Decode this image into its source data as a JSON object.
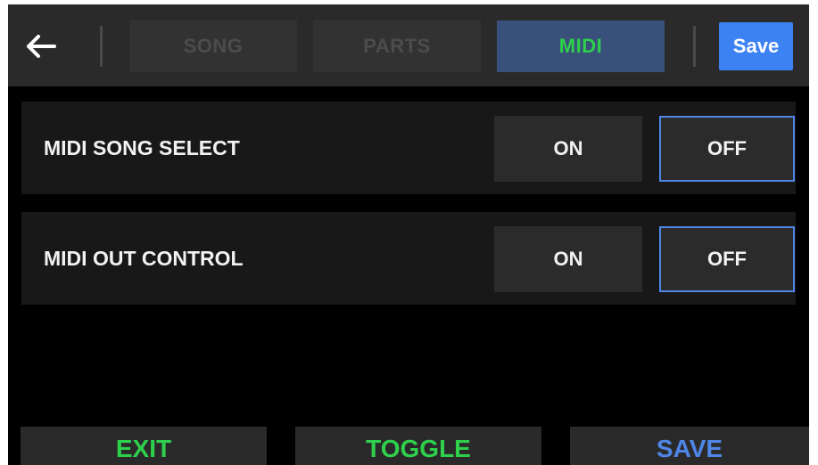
{
  "header": {
    "back_icon": "arrow-left-icon",
    "tabs": [
      {
        "label": "SONG",
        "active": false
      },
      {
        "label": "PARTS",
        "active": false
      },
      {
        "label": "MIDI",
        "active": true
      }
    ],
    "save_label": "Save"
  },
  "settings": [
    {
      "label": "MIDI SONG SELECT",
      "on_label": "ON",
      "off_label": "OFF",
      "selected": "OFF"
    },
    {
      "label": "MIDI OUT CONTROL",
      "on_label": "ON",
      "off_label": "OFF",
      "selected": "OFF"
    }
  ],
  "footer": {
    "exit_label": "EXIT",
    "toggle_label": "TOGGLE",
    "save_label": "SAVE"
  },
  "colors": {
    "active_tab_text": "#2ed04c",
    "active_tab_bg": "#38507a",
    "accent_blue": "#3d82f2",
    "selected_border": "#4f86e6",
    "footer_green": "#2ed04c",
    "footer_blue": "#4f86e6"
  }
}
